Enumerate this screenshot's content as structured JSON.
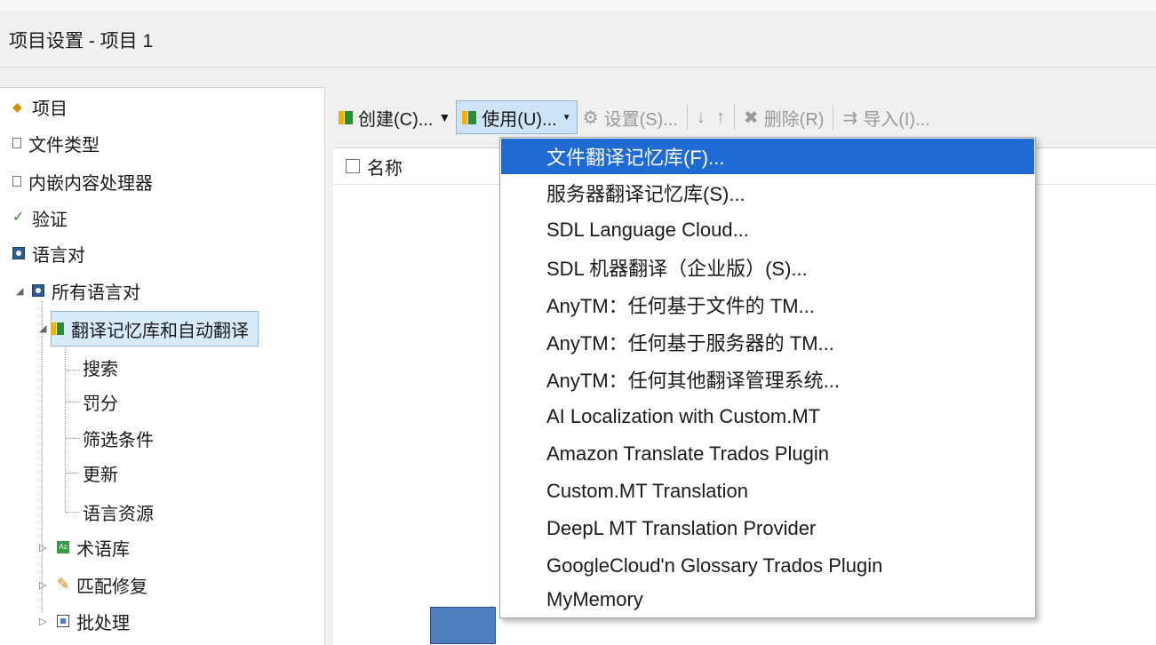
{
  "window": {
    "title": "项目设置 - 项目 1"
  },
  "tree": {
    "items": [
      {
        "label": "项目",
        "icon": "project-icon"
      },
      {
        "label": "文件类型",
        "icon": "document-icon"
      },
      {
        "label": "内嵌内容处理器",
        "icon": "document-icon"
      },
      {
        "label": "验证",
        "icon": "check-icon"
      },
      {
        "label": "语言对",
        "icon": "language-pair-icon"
      },
      {
        "label": "所有语言对",
        "icon": "language-pair-icon"
      },
      {
        "label": "翻译记忆库和自动翻译",
        "icon": "translation-memory-icon"
      },
      {
        "label": "搜索"
      },
      {
        "label": "罚分"
      },
      {
        "label": "筛选条件"
      },
      {
        "label": "更新"
      },
      {
        "label": "语言资源"
      },
      {
        "label": "术语库",
        "icon": "termbase-icon"
      },
      {
        "label": "匹配修复",
        "icon": "wrench-icon"
      },
      {
        "label": "批处理",
        "icon": "batch-icon"
      }
    ]
  },
  "toolbar": {
    "create_label": "创建(C)...",
    "use_label": "使用(U)...",
    "settings_label": "设置(S)...",
    "delete_label": "删除(R)",
    "import_label": "导入(I)..."
  },
  "list": {
    "col_name": "名称"
  },
  "menu": {
    "items": [
      "文件翻译记忆库(F)...",
      "服务器翻译记忆库(S)...",
      "SDL Language Cloud...",
      "SDL 机器翻译（企业版）(S)...",
      "AnyTM：任何基于文件的 TM...",
      "AnyTM：任何基于服务器的 TM...",
      "AnyTM：任何其他翻译管理系统...",
      "AI Localization with Custom.MT",
      "Amazon Translate Trados Plugin",
      "Custom.MT Translation",
      "DeepL MT Translation Provider",
      "GoogleCloud'n Glossary Trados Plugin",
      "MyMemory"
    ],
    "highlighted_index": 0
  },
  "colors": {
    "highlight": "#1f6ad3",
    "selection": "#d8ebfb"
  }
}
